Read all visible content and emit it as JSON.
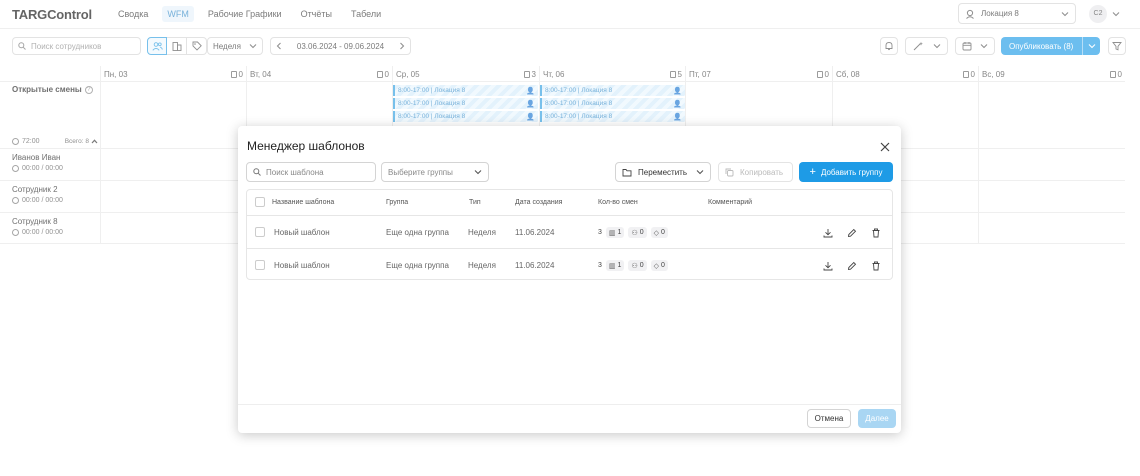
{
  "app": {
    "logo": "TARGControl"
  },
  "nav": [
    {
      "label": "Сводка",
      "active": false
    },
    {
      "label": "WFM",
      "active": true
    },
    {
      "label": "Рабочие Графики",
      "active": false
    },
    {
      "label": "Отчёты",
      "active": false
    },
    {
      "label": "Табели",
      "active": false
    }
  ],
  "location": {
    "label": "Локация 8"
  },
  "user": {
    "initials": "С2"
  },
  "toolbar": {
    "search_placeholder": "Поиск сотрудников",
    "period": "Неделя",
    "date_range": "03.06.2024 - 09.06.2024",
    "publish_label": "Опубликовать (8)"
  },
  "days": [
    {
      "label": "Пн, 03",
      "count": "0"
    },
    {
      "label": "Вт, 04",
      "count": "0"
    },
    {
      "label": "Ср, 05",
      "count": "3"
    },
    {
      "label": "Чт, 06",
      "count": "5"
    },
    {
      "label": "Пт, 07",
      "count": "0"
    },
    {
      "label": "Сб, 08",
      "count": "0"
    },
    {
      "label": "Вс, 09",
      "count": "0"
    }
  ],
  "open_shifts": {
    "title": "Открытые смены",
    "hours": "72:00",
    "total": "Всего: 8"
  },
  "shifts": [
    {
      "time": "8:00-17:00",
      "location": "Локация 8"
    },
    {
      "time": "8:00-17:00",
      "location": "Локация 8"
    },
    {
      "time": "8:00-17:00",
      "location": "Локация 8"
    },
    {
      "time": "8:00-17:00",
      "location": "Локация 8"
    },
    {
      "time": "8:00-17:00",
      "location": "Локация 8"
    },
    {
      "time": "8:00-17:00",
      "location": "Локация 8"
    }
  ],
  "employees": [
    {
      "name": "Иванов Иван",
      "time": "00:00 / 00:00"
    },
    {
      "name": "Сотрудник 2",
      "time": "00:00 / 00:00"
    },
    {
      "name": "Сотрудник 8",
      "time": "00:00 / 00:00"
    }
  ],
  "modal": {
    "title": "Менеджер шаблонов",
    "search_placeholder": "Поиск шаблона",
    "group_placeholder": "Выберите группы",
    "move_label": "Переместить",
    "copy_label": "Копировать",
    "add_group_label": "Добавить группу",
    "columns": [
      "Название шаблона",
      "Группа",
      "Тип",
      "Дата создания",
      "Кол-во смен",
      "Комментарий"
    ],
    "rows": [
      {
        "name": "Новый шаблон",
        "group": "Еще одна группа",
        "type": "Неделя",
        "date": "11.06.2024",
        "count": "3",
        "c1": "1",
        "c2": "0",
        "c3": "0"
      },
      {
        "name": "Новый шаблон",
        "group": "Еще одна группа",
        "type": "Неделя",
        "date": "11.06.2024",
        "count": "3",
        "c1": "1",
        "c2": "0",
        "c3": "0"
      }
    ],
    "cancel_label": "Отмена",
    "next_label": "Далее"
  }
}
